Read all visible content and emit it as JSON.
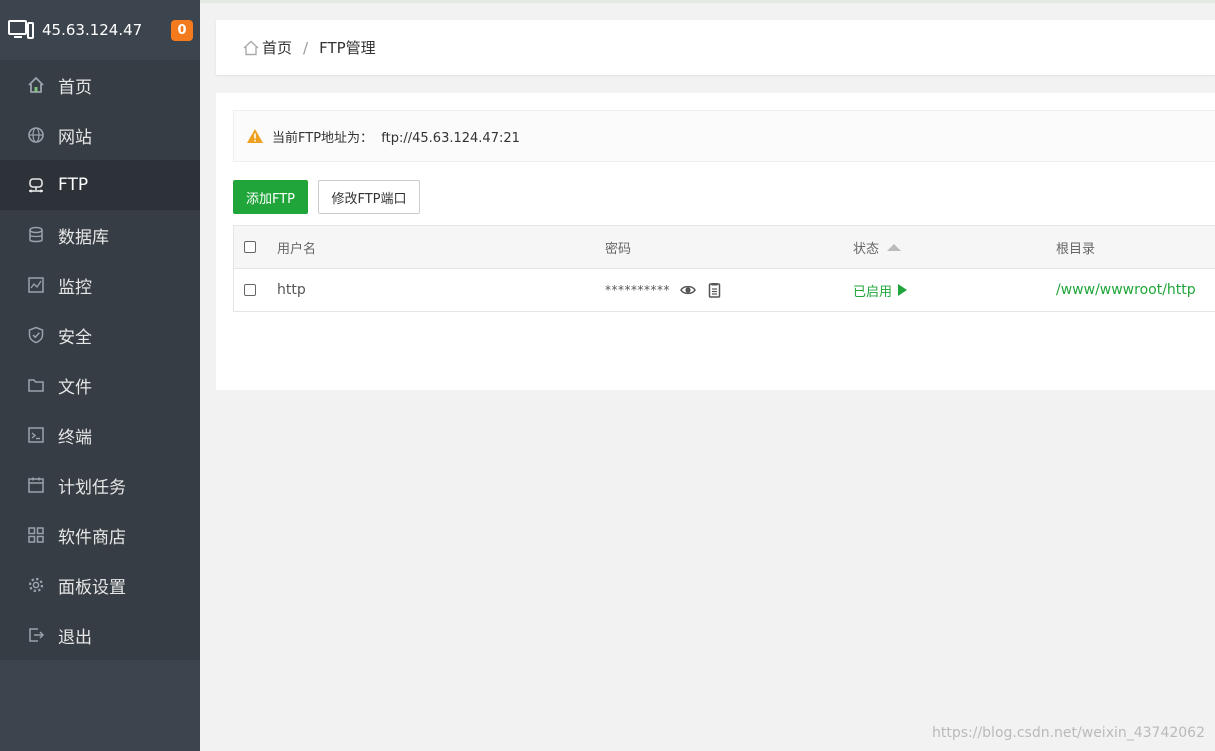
{
  "server": {
    "ip": "45.63.124.47",
    "badge": "0"
  },
  "sidebar": {
    "items": [
      {
        "label": "首页",
        "icon": "home-icon",
        "active": false
      },
      {
        "label": "网站",
        "icon": "globe-icon",
        "active": false
      },
      {
        "label": "FTP",
        "icon": "ftp-icon",
        "active": true
      },
      {
        "label": "数据库",
        "icon": "database-icon",
        "active": false
      },
      {
        "label": "监控",
        "icon": "monitor-icon",
        "active": false
      },
      {
        "label": "安全",
        "icon": "shield-icon",
        "active": false
      },
      {
        "label": "文件",
        "icon": "folder-icon",
        "active": false
      },
      {
        "label": "终端",
        "icon": "terminal-icon",
        "active": false
      },
      {
        "label": "计划任务",
        "icon": "calendar-icon",
        "active": false
      },
      {
        "label": "软件商店",
        "icon": "grid-icon",
        "active": false
      },
      {
        "label": "面板设置",
        "icon": "gear-icon",
        "active": false
      },
      {
        "label": "退出",
        "icon": "logout-icon",
        "active": false
      }
    ]
  },
  "breadcrumb": {
    "home": "首页",
    "separator": "/",
    "current": "FTP管理"
  },
  "alert": {
    "text": "当前FTP地址为：  ftp://45.63.124.47:21"
  },
  "toolbar": {
    "add_label": "添加FTP",
    "port_label": "修改FTP端口"
  },
  "table": {
    "columns": {
      "username": "用户名",
      "password": "密码",
      "status": "状态",
      "root": "根目录"
    },
    "rows": [
      {
        "username": "http",
        "password": "**********",
        "status": "已启用",
        "root": "/www/wwwroot/http"
      }
    ]
  },
  "watermark": "https://blog.csdn.net/weixin_43742062",
  "colors": {
    "sidebar": "#3c444d",
    "accent": "#20a53a",
    "badge": "#f37b1d",
    "warning": "#f0a020"
  }
}
